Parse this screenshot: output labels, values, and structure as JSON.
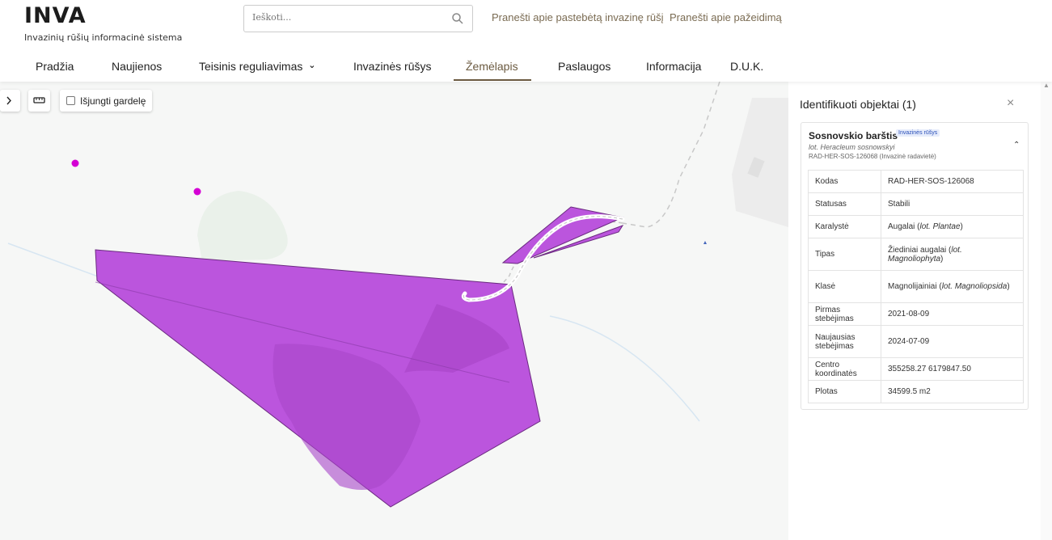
{
  "header": {
    "logo": "INVA",
    "tagline": "Invazinių rūšių informacinė sistema",
    "search_placeholder": "Ieškoti...",
    "links": [
      "Pranešti apie pastebėtą invazinę rūšį",
      "Pranešti apie pažeidimą"
    ]
  },
  "nav": {
    "items": [
      {
        "label": "Pradžia"
      },
      {
        "label": "Naujienos"
      },
      {
        "label": "Teisinis reguliavimas",
        "has_dropdown": true
      },
      {
        "label": "Invazinės rūšys"
      },
      {
        "label": "Žemėlapis",
        "active": true
      },
      {
        "label": "Paslaugos"
      },
      {
        "label": "Informacija"
      },
      {
        "label": "D.U.K."
      }
    ],
    "dropdown_glyph": "⌄"
  },
  "map": {
    "grid_toggle_label": "Išjungti gardelę",
    "grid_toggle_checked": false,
    "polygon_color": "#bb55dd",
    "point_color": "#d400d4"
  },
  "panel": {
    "title": "Identifikuoti objektai (1)",
    "close_glyph": "×",
    "object": {
      "name": "Sosnovskio barštis",
      "badge": "Invazinės rūšys",
      "latin": "lot. Heracleum sosnowskyi",
      "code_line": "RAD-HER-SOS-126068 (Invazinė radavietė)",
      "collapse_glyph": "⌃",
      "attributes": [
        {
          "key": "Kodas",
          "value": "RAD-HER-SOS-126068"
        },
        {
          "key": "Statusas",
          "value": "Stabili"
        },
        {
          "key": "Karalystė",
          "value": "Augalai (",
          "italic": "lot. Plantae",
          "after": ")"
        },
        {
          "key": "Tipas",
          "value": "Žiediniai augalai (",
          "italic": "lot. Magnoliophyta",
          "after": ")"
        },
        {
          "key": "Klasė",
          "value": "Magnolijainiai (",
          "italic": "lot. Magnoliopsida",
          "after": ")"
        },
        {
          "key": "Pirmas stebėjimas",
          "value": "2021-08-09"
        },
        {
          "key": "Naujausias stebėjimas",
          "value": "2024-07-09"
        },
        {
          "key": "Centro koordinatės",
          "value": "355258.27 6179847.50"
        },
        {
          "key": "Plotas",
          "value": "34599.5 m2"
        }
      ]
    }
  }
}
